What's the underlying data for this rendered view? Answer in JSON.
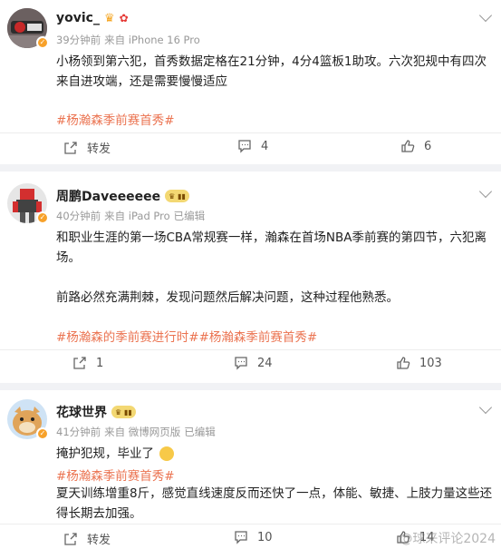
{
  "posts": [
    {
      "username": "yovic_",
      "meta_time": "39分钟前",
      "meta_source": "来自 iPhone 16 Pro",
      "meta_edited": "",
      "text": "小杨领到第六犯，首秀数据定格在21分钟，4分4篮板1助攻。六次犯规中有四次来自进攻端，还是需要慢慢适应",
      "hashtags": "#杨瀚森季前赛首秀#",
      "text2": "",
      "repost_label": "转发",
      "comment_count": "4",
      "like_count": "6"
    },
    {
      "username": "周鹏Daveeeeee",
      "meta_time": "40分钟前",
      "meta_source": "来自 iPad Pro",
      "meta_edited": "已编辑",
      "text": "和职业生涯的第一场CBA常规赛一样，瀚森在首场NBA季前赛的第四节，六犯离场。",
      "text2": "前路必然充满荆棘，发现问题然后解决问题，这种过程他熟悉。",
      "hashtags": "#杨瀚森的季前赛进行时##杨瀚森季前赛首秀#",
      "repost_count": "1",
      "comment_count": "24",
      "like_count": "103"
    },
    {
      "username": "花球世界",
      "meta_time": "41分钟前",
      "meta_source": "来自 微博网页版",
      "meta_edited": "已编辑",
      "text": "掩护犯规，毕业了",
      "hashtags": "#杨瀚森季前赛首秀#",
      "text2": "夏天训练增重8斤，感觉直线速度反而还快了一点，体能、敏捷、上肢力量这些还得长期去加强。",
      "repost_label": "转发",
      "comment_count": "10",
      "like_count": "14"
    }
  ],
  "watermark": "@球来评论2024",
  "colors": {
    "hashtag": "#eb7350",
    "meta": "#999999",
    "separator": "#f1f2f5"
  },
  "icons": [
    "share-icon",
    "comment-icon",
    "like-icon",
    "chevron-down-icon",
    "verified-badge-icon",
    "level-badge-icon",
    "laughing-emoji-icon"
  ]
}
